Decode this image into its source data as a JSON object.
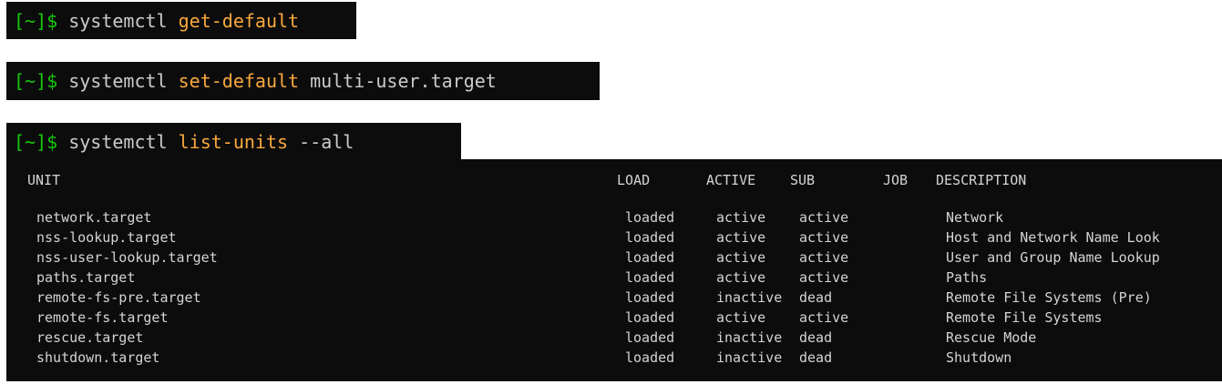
{
  "commands": [
    {
      "prompt": "[~]$",
      "program": "systemctl",
      "subcommand": "get-default",
      "args": ""
    },
    {
      "prompt": "[~]$",
      "program": "systemctl",
      "subcommand": "set-default",
      "args": "multi-user.target"
    },
    {
      "prompt": "[~]$",
      "program": "systemctl",
      "subcommand": "list-units",
      "args": "--all"
    }
  ],
  "output": {
    "headers": {
      "unit": "UNIT",
      "load": "LOAD",
      "active": "ACTIVE",
      "sub": "SUB",
      "job": "JOB",
      "description": "DESCRIPTION"
    },
    "rows": [
      {
        "unit": "network.target",
        "load": "loaded",
        "active": "active",
        "sub": "active",
        "description": "Network"
      },
      {
        "unit": "nss-lookup.target",
        "load": "loaded",
        "active": "active",
        "sub": "active",
        "description": "Host and Network Name Look"
      },
      {
        "unit": "nss-user-lookup.target",
        "load": "loaded",
        "active": "active",
        "sub": "active",
        "description": "User and Group Name Lookup"
      },
      {
        "unit": "paths.target",
        "load": "loaded",
        "active": "active",
        "sub": "active",
        "description": "Paths"
      },
      {
        "unit": "remote-fs-pre.target",
        "load": "loaded",
        "active": "inactive",
        "sub": "dead",
        "description": "Remote File Systems (Pre)"
      },
      {
        "unit": "remote-fs.target",
        "load": "loaded",
        "active": "active",
        "sub": "active",
        "description": "Remote File Systems"
      },
      {
        "unit": "rescue.target",
        "load": "loaded",
        "active": "inactive",
        "sub": "dead",
        "description": "Rescue Mode"
      },
      {
        "unit": "shutdown.target",
        "load": "loaded",
        "active": "inactive",
        "sub": "dead",
        "description": "Shutdown"
      }
    ]
  },
  "colors": {
    "terminal_bg": "#0c0c0c",
    "prompt": "#16c60c",
    "subcommand": "#f9a83d",
    "text": "#cccccc"
  }
}
